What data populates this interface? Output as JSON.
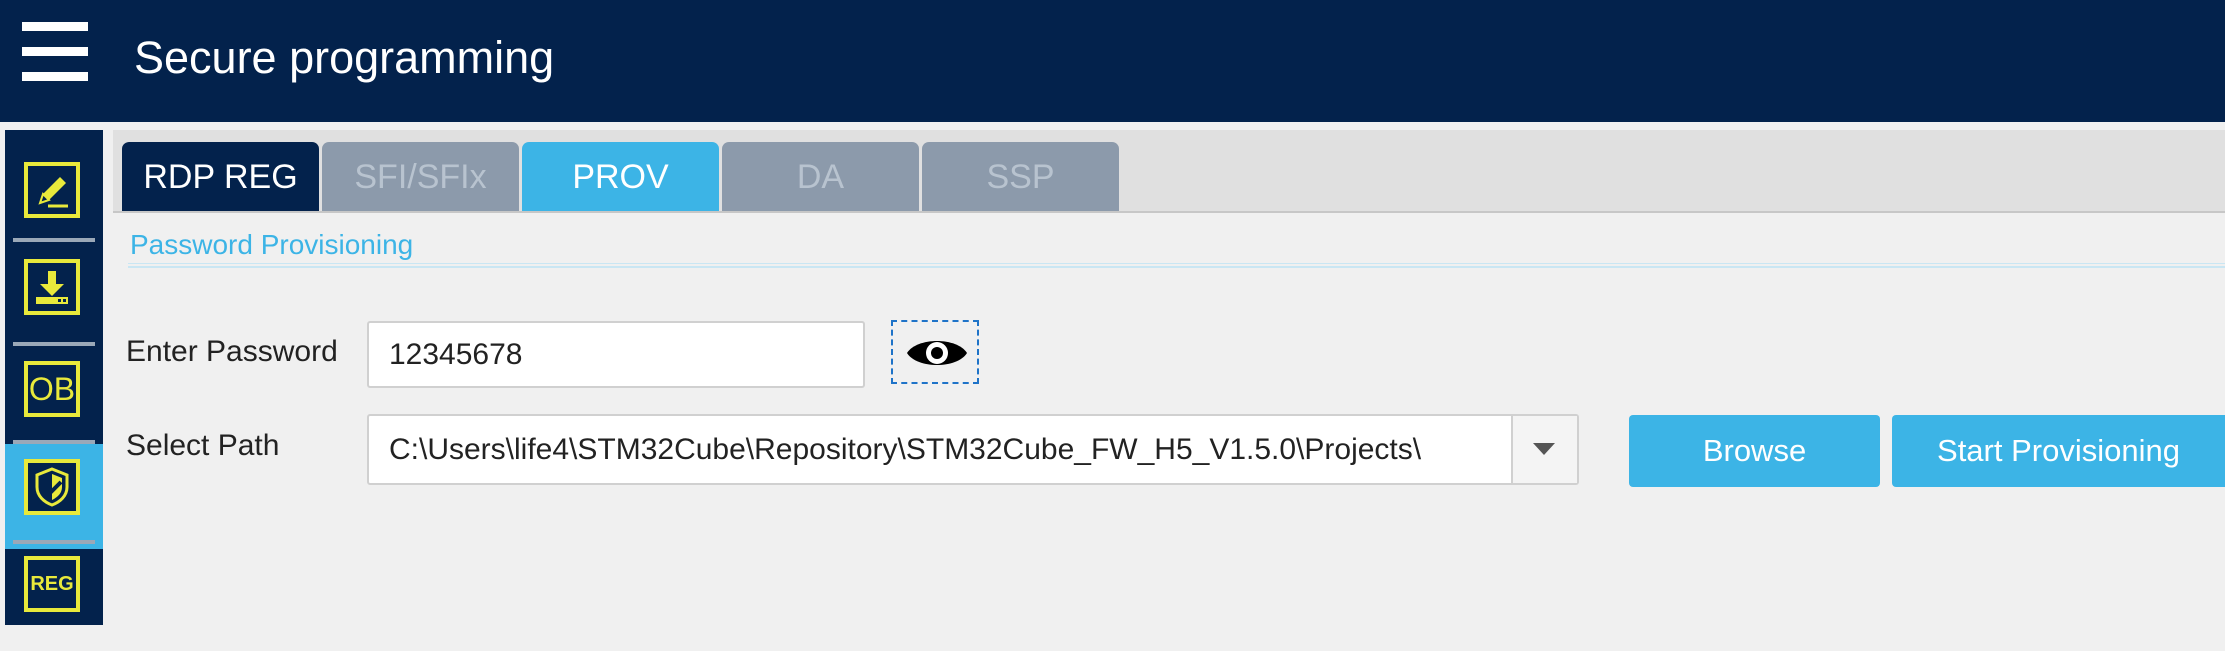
{
  "window": {
    "title": "Secure programming"
  },
  "sidebar": {
    "items": [
      {
        "name": "edit",
        "icon": "edit-pencil-icon",
        "active": false
      },
      {
        "name": "download",
        "icon": "download-icon",
        "active": false
      },
      {
        "name": "option-bytes",
        "icon": "option-bytes-icon",
        "label": "OB",
        "active": false
      },
      {
        "name": "security",
        "icon": "shield-icon",
        "active": true
      },
      {
        "name": "registers",
        "icon": "registers-icon",
        "label": "REG",
        "active": false
      }
    ]
  },
  "tabs": [
    {
      "label": "RDP REG",
      "state": "normal"
    },
    {
      "label": "SFI/SFIx",
      "state": "disabled"
    },
    {
      "label": "PROV",
      "state": "selected"
    },
    {
      "label": "DA",
      "state": "disabled"
    },
    {
      "label": "SSP",
      "state": "disabled"
    }
  ],
  "provisioning": {
    "section_title": "Password Provisioning",
    "password_label": "Enter Password",
    "password_value": "12345678",
    "visibility_icon": "eye-icon",
    "path_label": "Select Path",
    "path_value": "C:\\Users\\life4\\STM32Cube\\Repository\\STM32Cube_FW_H5_V1.5.0\\Projects\\",
    "browse_label": "Browse",
    "start_label": "Start Provisioning"
  },
  "colors": {
    "navy": "#03224c",
    "accent": "#3cb4e6",
    "icon_yellow": "#e8e93b",
    "disabled_tab": "#8c9aab"
  }
}
